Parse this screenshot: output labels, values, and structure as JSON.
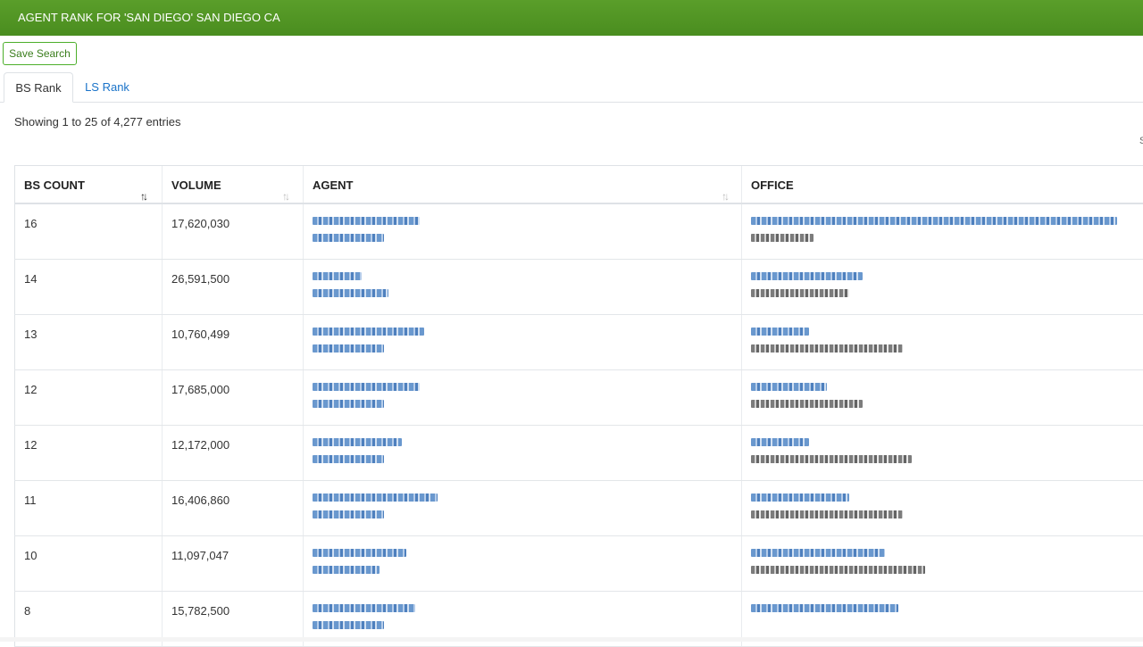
{
  "header": {
    "title": "AGENT RANK FOR 'SAN DIEGO' SAN DIEGO CA"
  },
  "toolbar": {
    "save_label": "Save Search"
  },
  "tabs": [
    {
      "label": "BS Rank",
      "active": true
    },
    {
      "label": "LS Rank",
      "active": false
    }
  ],
  "info": {
    "showing": "Showing 1 to 25 of 4,277 entries",
    "edge_char": "S"
  },
  "table": {
    "columns": [
      "BS COUNT",
      "VOLUME",
      "AGENT",
      "OFFICE"
    ],
    "sort_icons": {
      "active": "↑↓",
      "inactive": "↑↓"
    },
    "rows": [
      {
        "bs_count": "16",
        "volume": "17,620,030"
      },
      {
        "bs_count": "14",
        "volume": "26,591,500"
      },
      {
        "bs_count": "13",
        "volume": "10,760,499"
      },
      {
        "bs_count": "12",
        "volume": "17,685,000"
      },
      {
        "bs_count": "12",
        "volume": "12,172,000"
      },
      {
        "bs_count": "11",
        "volume": "16,406,860"
      },
      {
        "bs_count": "10",
        "volume": "11,097,047"
      },
      {
        "bs_count": "8",
        "volume": "15,782,500"
      }
    ]
  },
  "colors": {
    "header_green": "#4a8d1f",
    "link_blue": "#1a73c9"
  }
}
